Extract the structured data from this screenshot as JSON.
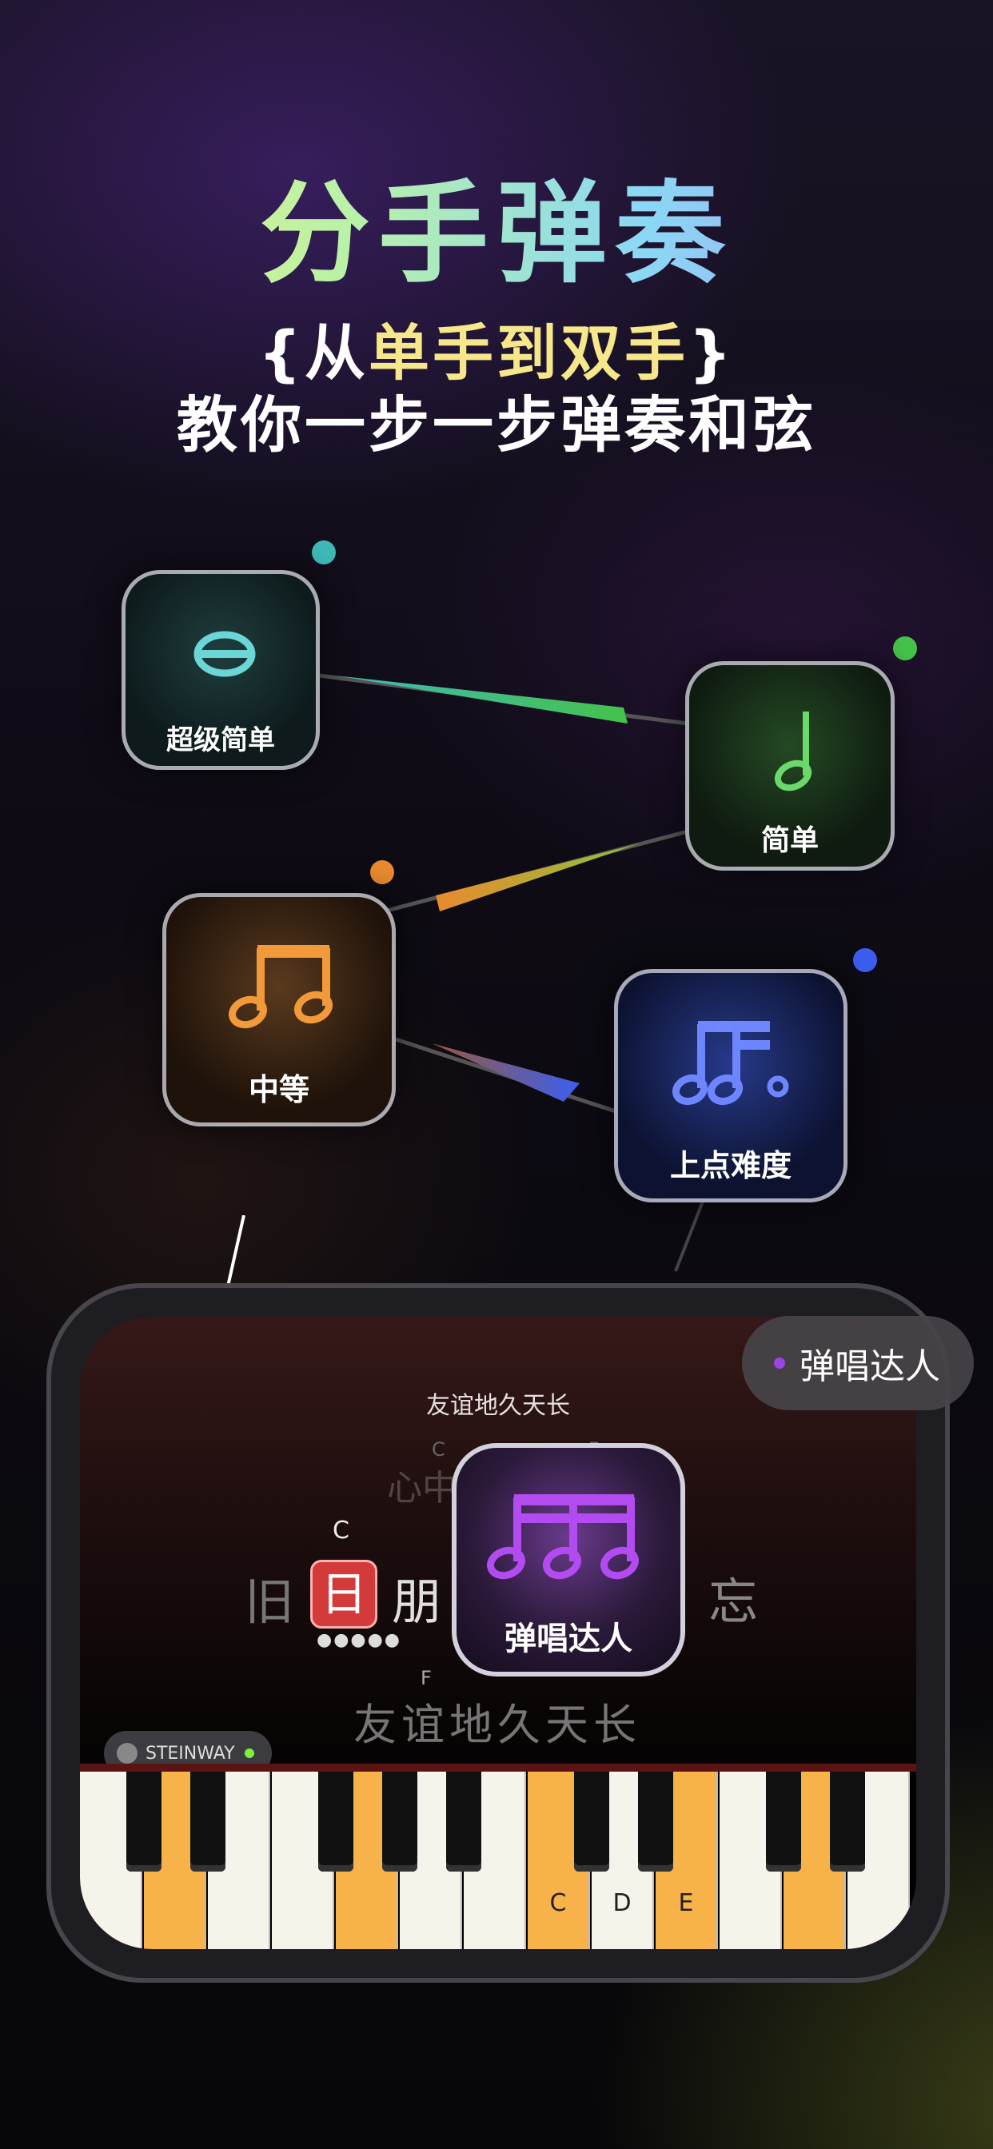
{
  "header": {
    "title": "分手弹奏",
    "subtitle_open": "{从",
    "subtitle_hl": "单手到双手",
    "subtitle_close": "}",
    "subtitle2": "教你一步一步弹奏和弦"
  },
  "levels": [
    {
      "label": "超级简单",
      "icon": "whole-note-icon",
      "color": "#3fb8b8"
    },
    {
      "label": "简单",
      "icon": "half-note-icon",
      "color": "#45c24a"
    },
    {
      "label": "中等",
      "icon": "eighth-notes-icon",
      "color": "#e98a2e"
    },
    {
      "label": "上点难度",
      "icon": "sixteenth-notes-icon",
      "color": "#3b5ef0"
    }
  ],
  "player": {
    "song_title": "友谊地久天长",
    "chord_c_top": "C",
    "chord_f_top": "F",
    "faint_line": "心中",
    "current_line": {
      "before": "旧",
      "highlight": "日",
      "after": "朋",
      "end": "忘"
    },
    "current_chord": "C",
    "next_chord": "F",
    "next_line": "友谊地久天长",
    "instrument": "STEINWAY",
    "mode_pill": "弹唱达人",
    "card_label": "弹唱达人",
    "key_labels": [
      "C",
      "D",
      "E"
    ]
  }
}
